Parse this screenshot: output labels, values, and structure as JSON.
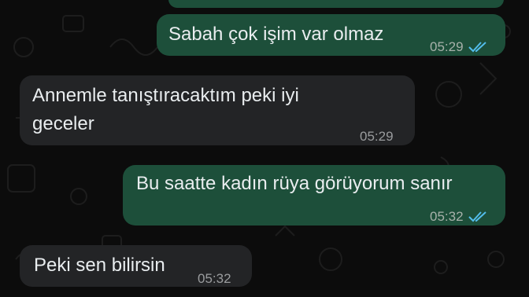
{
  "colors": {
    "outgoing_bubble": "#1d4f3a",
    "incoming_bubble": "#232426",
    "read_ticks": "#53bdeb",
    "background": "#0c0c0c"
  },
  "messages": [
    {
      "direction": "outgoing",
      "text": "Sabah çok işim var olmaz",
      "time": "05:29",
      "status": "read-double-check-icon"
    },
    {
      "direction": "incoming",
      "text_line1": "Annemle tanıştıracaktım peki iyi",
      "text_line2": "geceler",
      "time": "05:29"
    },
    {
      "direction": "outgoing",
      "text": "Bu saatte kadın rüya görüyorum sanır",
      "time": "05:32",
      "status": "read-double-check-icon"
    },
    {
      "direction": "incoming",
      "text": "Peki sen bilirsin",
      "time": "05:32"
    }
  ]
}
